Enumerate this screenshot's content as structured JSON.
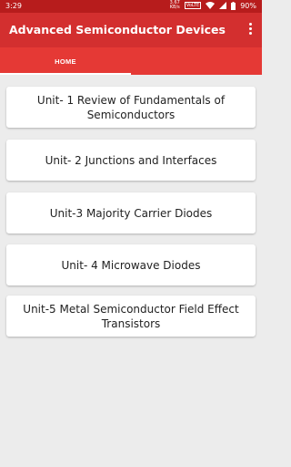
{
  "status_bar": {
    "time": "3:29",
    "net_speed_value": "3.67",
    "net_speed_unit": "KB/s",
    "volte": "VoLTE",
    "battery": "90%"
  },
  "app_bar": {
    "title": "Advanced Semiconductor Devices",
    "menu_icon": "more-vert-icon"
  },
  "tabs": [
    {
      "label": "HOME",
      "active": true
    },
    {
      "label": "",
      "active": false
    }
  ],
  "units": [
    {
      "label": "Unit- 1 Review of Fundamentals of Semiconductors"
    },
    {
      "label": "Unit- 2 Junctions and Interfaces"
    },
    {
      "label": "Unit-3 Majority Carrier Diodes"
    },
    {
      "label": "Unit- 4 Microwave Diodes"
    },
    {
      "label": "Unit-5 Metal Semiconductor Field Effect Transistors"
    }
  ],
  "colors": {
    "status_bar": "#b71c1c",
    "app_bar": "#d32f2f",
    "tab_bar": "#e53935",
    "background": "#ececec"
  }
}
